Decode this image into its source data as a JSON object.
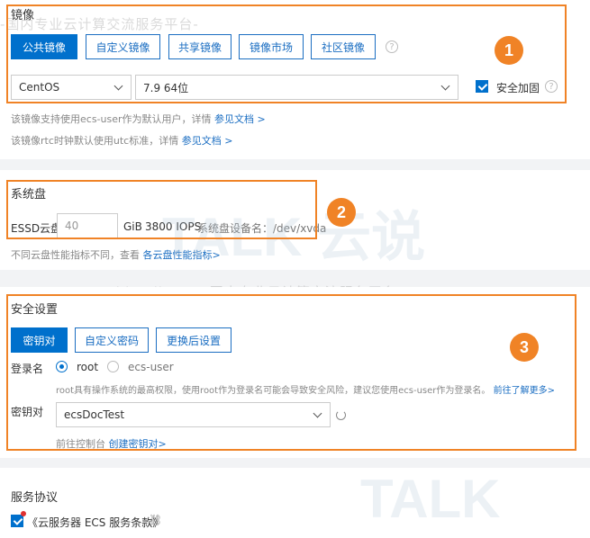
{
  "watermark": {
    "line1": "-国内专业云计算交流服务平台-",
    "line2": "-www.idctalk.com-国内专业云计算交流服务平台-",
    "brand1": "TALK 云说",
    "brand2": "TALK"
  },
  "image": {
    "title": "镜像",
    "tabs": [
      "公共镜像",
      "自定义镜像",
      "共享镜像",
      "镜像市场",
      "社区镜像"
    ],
    "os_select": "CentOS",
    "version_select": "7.9 64位",
    "security_label": "安全加固",
    "hint1": "该镜像支持使用ecs-user作为默认用户，详情",
    "hint1_link": "参见文档 >",
    "hint2": "该镜像rtc时钟默认使用utc标准，详情",
    "hint2_link": "参见文档 >"
  },
  "disk": {
    "title": "系统盘",
    "type_label": "ESSD云盘",
    "size_value": "40",
    "unit": "GiB",
    "iops": "3800 IOPS",
    "device_label": "系统盘设备名：/dev/xvda",
    "hint": "不同云盘性能指标不同，查看",
    "hint_link": "各云盘性能指标>"
  },
  "security": {
    "title": "安全设置",
    "tabs": [
      "密钥对",
      "自定义密码",
      "更换后设置"
    ],
    "login_label": "登录名",
    "login_options": [
      "root",
      "ecs-user"
    ],
    "login_hint": "root具有操作系统的最高权限，使用root作为登录名可能会导致安全风险，建议您使用ecs-user作为登录名。",
    "login_hint_link": "前往了解更多>",
    "keypair_label": "密钥对",
    "keypair_value": "ecsDocTest",
    "console_hint": "前往控制台",
    "console_link": "创建密钥对>"
  },
  "agreement": {
    "title": "服务协议",
    "item": "《云服务器 ECS 服务条款》"
  },
  "annotations": [
    "1",
    "2",
    "3"
  ],
  "colors": {
    "accent": "#0070cc",
    "annotation": "#f08326"
  }
}
